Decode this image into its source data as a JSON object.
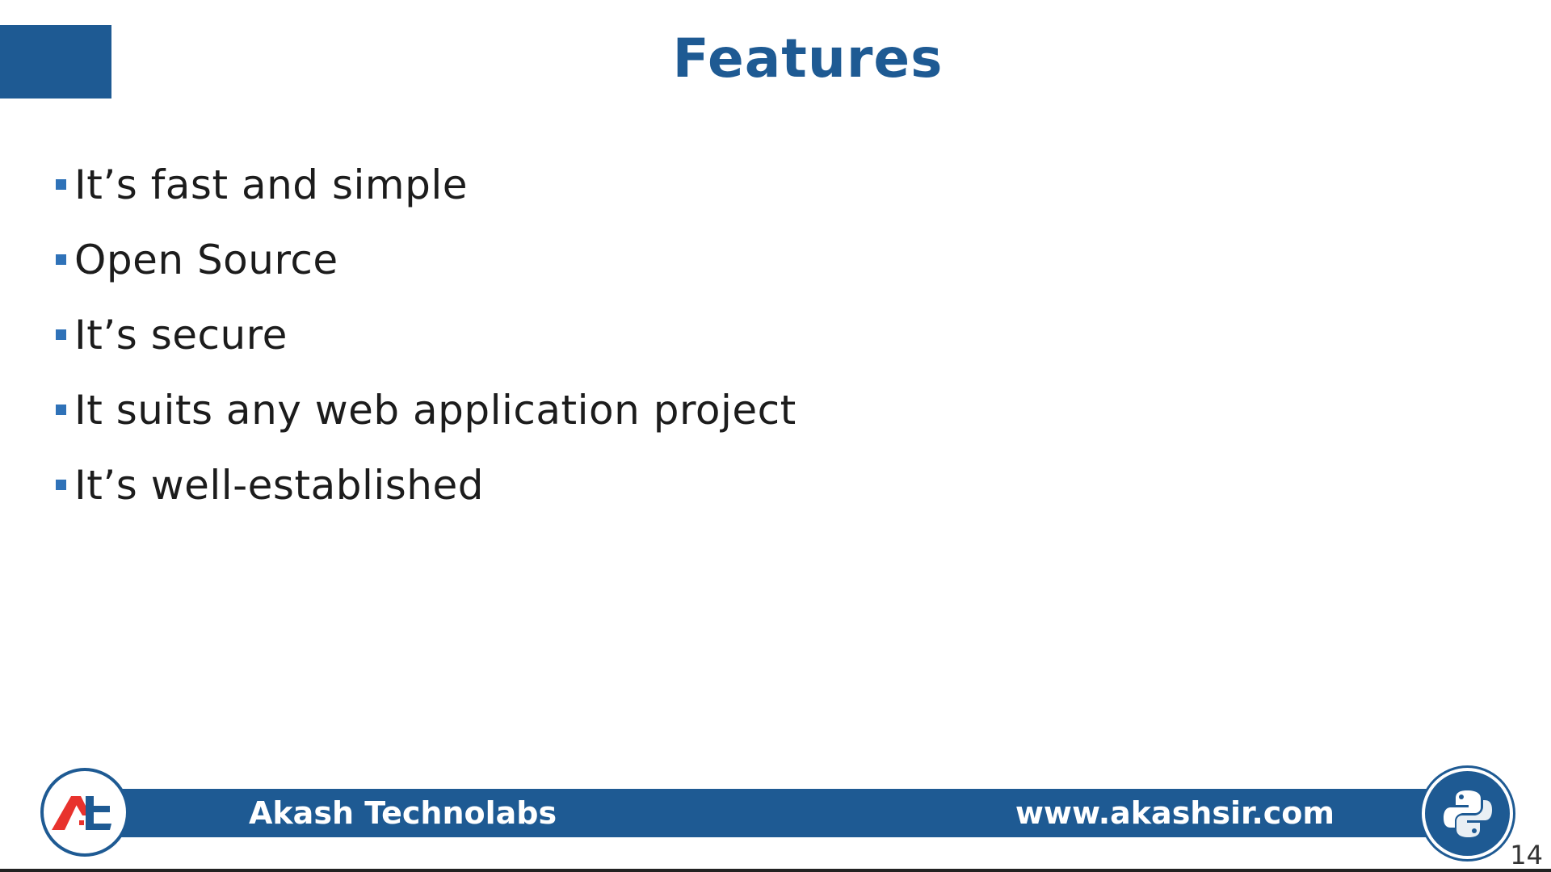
{
  "slide": {
    "title": "Features",
    "bullets": [
      "It’s fast and simple",
      "Open Source",
      "It’s secure",
      "It suits any web application project",
      "It’s well-established"
    ],
    "page_number": "14"
  },
  "footer": {
    "company": "Akash Technolabs",
    "url": "www.akashsir.com"
  },
  "icons": {
    "left_logo": "akash-technolabs-logo",
    "right_logo": "python-logo",
    "bullet": "square-bullet"
  },
  "colors": {
    "brand_blue": "#1e5a93",
    "bullet_blue": "#2f72b8",
    "logo_red": "#e8322d",
    "python_yellow": "#ffffff"
  }
}
